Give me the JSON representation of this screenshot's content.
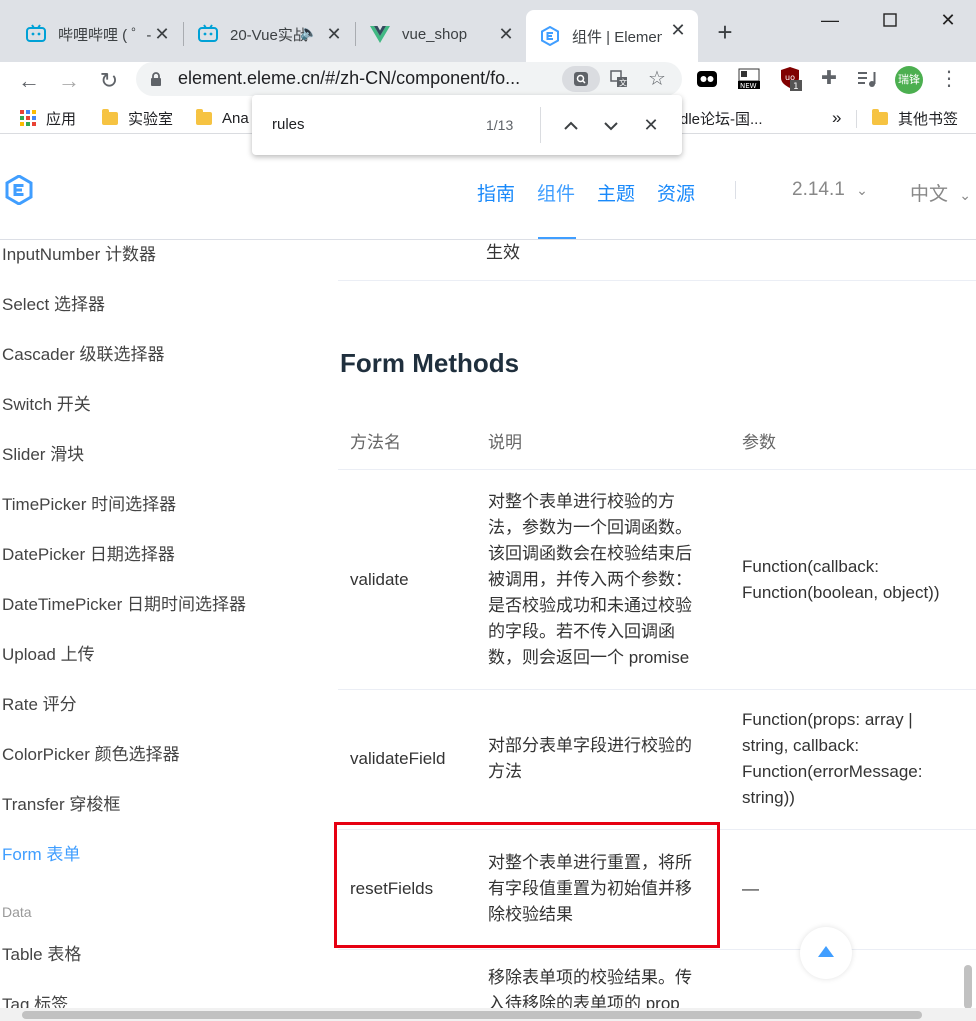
{
  "tabs": [
    {
      "title": "哔哩哔哩 ( ゜- ゜)つロ",
      "icon": "bilibili-icon"
    },
    {
      "title": "20-Vue实战",
      "icon": "bilibili-icon"
    },
    {
      "title": "vue_shop",
      "icon": "vue-icon"
    },
    {
      "title": "组件 | Element",
      "icon": "element-icon"
    }
  ],
  "address_bar": {
    "url": "element.eleme.cn/#/zh-CN/component/fo..."
  },
  "profile": {
    "name": "瑞锋"
  },
  "extension_badge": "1",
  "bookmarks": {
    "apps": "应用",
    "items": [
      "实验室",
      "Ana",
      "dle论坛-国...",
      "其他书签"
    ],
    "more": "»"
  },
  "find": {
    "query": "rules",
    "count": "1/13"
  },
  "site": {
    "nav": [
      "指南",
      "组件",
      "主题",
      "资源"
    ],
    "version": "2.14.1",
    "language": "中文"
  },
  "sidebar": {
    "items": [
      "InputNumber 计数器",
      "Select 选择器",
      "Cascader 级联选择器",
      "Switch 开关",
      "Slider 滑块",
      "TimePicker 时间选择器",
      "DatePicker 日期选择器",
      "DateTimePicker 日期时间选择器",
      "Upload 上传",
      "Rate 评分",
      "ColorPicker 颜色选择器",
      "Transfer 穿梭框",
      "Form 表单"
    ],
    "group": "Data",
    "data_items": [
      "Table 表格",
      "Tag 标签"
    ]
  },
  "content": {
    "prev_cell": "生效",
    "section_title": "Form Methods",
    "headers": [
      "方法名",
      "说明",
      "参数"
    ],
    "rows": [
      {
        "name": "validate",
        "desc": [
          "对整个表单进行校验的方",
          "法，参数为一个回调函数。",
          "该回调函数会在校验结束后",
          "被调用，并传入两个参数：",
          "是否校验成功和未通过校验",
          "的字段。若不传入回调函",
          "数，则会返回一个 promise"
        ],
        "params": [
          "Function(callback:",
          "Function(boolean, object))"
        ]
      },
      {
        "name": "validateField",
        "desc": [
          "对部分表单字段进行校验的",
          "方法"
        ],
        "params": [
          "Function(props: array |",
          "string, callback:",
          "Function(errorMessage:",
          "string))"
        ]
      },
      {
        "name": "resetFields",
        "desc": [
          "对整个表单进行重置，将所",
          "有字段值重置为初始值并移",
          "除校验结果"
        ],
        "params": [
          "—"
        ]
      },
      {
        "name": "",
        "desc": [
          "移除表单项的校验结果。传",
          "入待移除的表单项的 prop"
        ],
        "params": []
      }
    ]
  },
  "colors": {
    "accent": "#409eff",
    "highlight": "#e60012"
  }
}
